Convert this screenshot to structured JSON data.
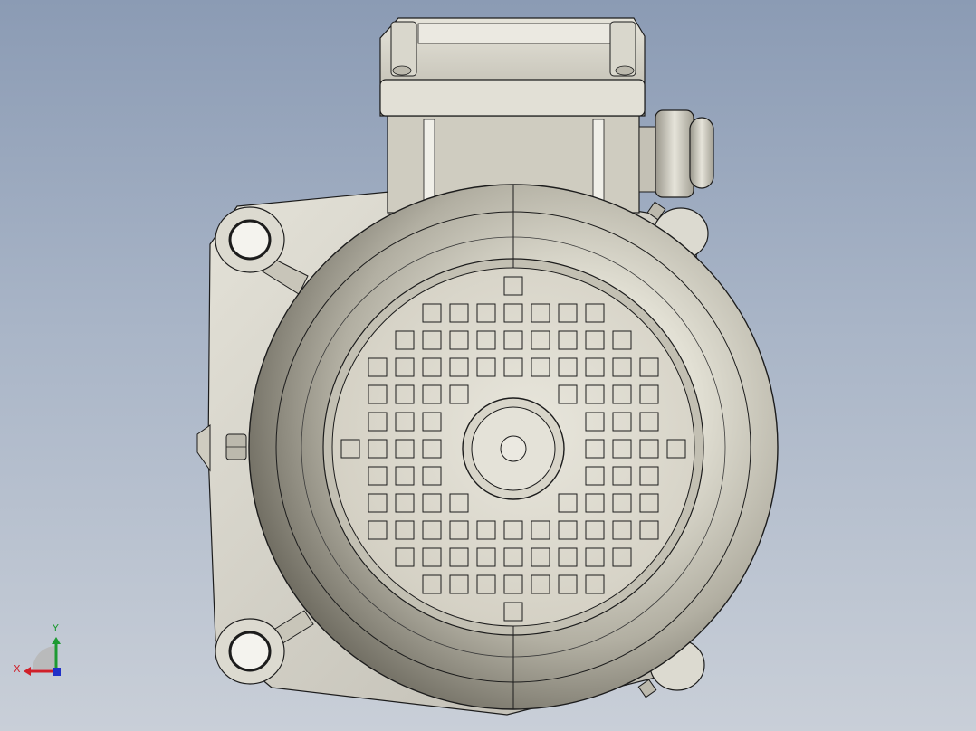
{
  "viewport": {
    "background_top": "#8b9bb4",
    "background_bottom": "#c9cfd8"
  },
  "model": {
    "body_color": "#d6d3c6",
    "edge_color": "#1c1c1c",
    "fan_cover_vent_grid": "square vents",
    "parts": [
      "terminal-box",
      "cable-gland",
      "flange-plate",
      "fan-cover",
      "fan-cover-hub"
    ]
  },
  "triad": {
    "x_label": "X",
    "y_label": "Y",
    "x_color": "#d0202a",
    "y_color": "#1e9a32",
    "z_color": "#2030c8"
  }
}
